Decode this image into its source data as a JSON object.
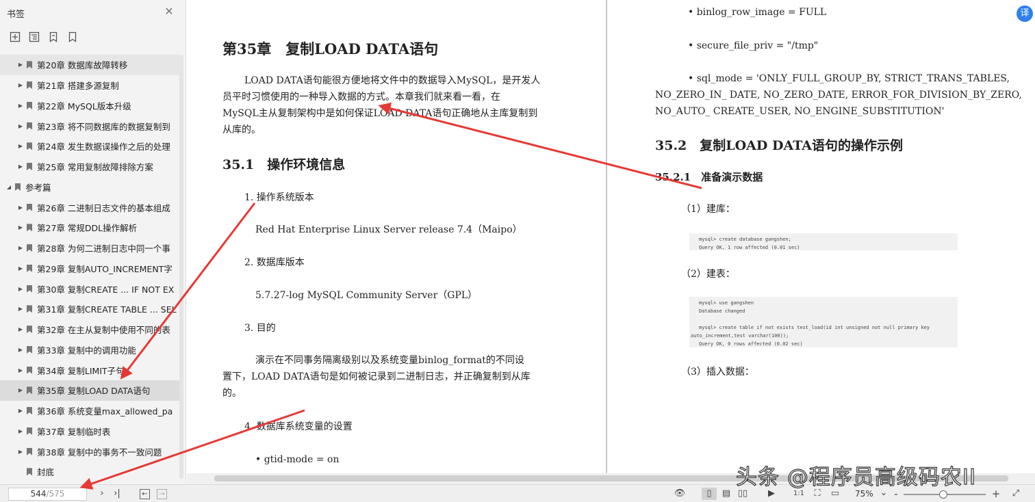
{
  "sidebar": {
    "title": "书签",
    "items": [
      {
        "label": "第20章 数据库故障转移",
        "expanded": false
      },
      {
        "label": "第21章 搭建多源复制",
        "expanded": false
      },
      {
        "label": "第22章 MySQL版本升级",
        "expanded": false
      },
      {
        "label": "第23章 将不同数据库的数据复制到",
        "expanded": false
      },
      {
        "label": "第24章 发生数据误操作之后的处理",
        "expanded": false
      },
      {
        "label": "第25章 常用复制故障排除方案",
        "expanded": false
      },
      {
        "label": "参考篇",
        "expanded": true
      },
      {
        "label": "第26章 二进制日志文件的基本组成",
        "expanded": false
      },
      {
        "label": "第27章 常规DDL操作解析",
        "expanded": false
      },
      {
        "label": "第28章 为何二进制日志中同一个事",
        "expanded": false
      },
      {
        "label": "第29章 复制AUTO_INCREMENT字",
        "expanded": false
      },
      {
        "label": "第30章 复制CREATE ... IF NOT EX",
        "expanded": false
      },
      {
        "label": "第31章 复制CREATE TABLE ... SEL",
        "expanded": false
      },
      {
        "label": "第32章 在主从复制中使用不同的表",
        "expanded": false
      },
      {
        "label": "第33章 复制中的调用功能",
        "expanded": false
      },
      {
        "label": "第34章 复制LIMIT子句",
        "expanded": false
      },
      {
        "label": "第35章 复制LOAD DATA语句",
        "expanded": false
      },
      {
        "label": "第36章 系统变量max_allowed_pa",
        "expanded": false
      },
      {
        "label": "第37章 复制临时表",
        "expanded": false
      },
      {
        "label": "第38章 复制中的事务不一致问题",
        "expanded": false
      },
      {
        "label": "封底",
        "expanded": null
      }
    ]
  },
  "left_page": {
    "chapter_title": "第35章　复制LOAD DATA语句",
    "intro": [
      "LOAD DATA语句能很方便地将文件中的数据导入MySQL，是开发人",
      "员平时习惯使用的一种导入数据的方式。本章我们就来看一看，在",
      "MySQL主从复制架构中是如何保证LOAD DATA语句正确地从主库复制到",
      "从库的。"
    ],
    "section1_title": "35.1　操作环境信息",
    "item1": "1. 操作系统版本",
    "item1_value": "Red Hat Enterprise Linux Server release 7.4（Maipo）",
    "item2": "2. 数据库版本",
    "item2_value": "5.7.27-log MySQL Community Server（GPL）",
    "item3": "3. 目的",
    "item3_text": [
      "演示在不同事务隔离级别以及系统变量binlog_format的不同设",
      "置下，LOAD DATA语句是如何被记录到二进制日志，并正确复制到从库",
      "的。"
    ],
    "item4": "4. 数据库系统变量的设置",
    "bullet_gtid": "• gtid-mode = on"
  },
  "right_page": {
    "bullet_binlog": "• binlog_row_image = FULL",
    "bullet_secure": "• secure_file_priv = \"/tmp\"",
    "sql_mode": [
      "• sql_mode = 'ONLY_FULL_GROUP_BY, STRICT_TRANS_TABLES,",
      "NO_ZERO_IN_ DATE, NO_ZERO_DATE, ERROR_FOR_DIVISION_BY_ZERO,",
      "NO_AUTO_ CREATE_USER, NO_ENGINE_SUBSTITUTION'"
    ],
    "section2_title": "35.2　复制LOAD DATA语句的操作示例",
    "subsection_title": "35.2.1　准备演示数据",
    "step1": "（1）建库：",
    "code1": [
      "mysql> create database gangshen;",
      "Query OK, 1 row affected (0.01 sec)"
    ],
    "step2": "（2）建表：",
    "code2": [
      "mysql> use gangshen",
      "Database changed",
      "",
      "mysql> create table if not exists test_load(id int unsigned not null primary key",
      "auto_increment,test varchar(100));",
      "Query OK, 0 rows affected (0.02 sec)"
    ],
    "step3": "（3）插入数据："
  },
  "statusbar": {
    "current_page": "544",
    "total_pages": "/575",
    "zoom": "75%",
    "zoom_minus": "-",
    "zoom_plus": "+"
  },
  "watermark": "头条 @程序员高级码农II",
  "colors": {
    "arrow": "#e53935",
    "selected_bookmark": "#dcdcdc"
  },
  "icons": [
    "add-bookmark-icon",
    "add-child-bookmark-icon",
    "bookmark-icon",
    "bookmark-outline-icon",
    "close-icon",
    "next-page-icon",
    "last-page-icon",
    "back-icon",
    "forward-icon",
    "eye-icon",
    "single-page-icon",
    "continuous-page-icon",
    "two-page-icon",
    "play-icon",
    "actual-size-icon",
    "fit-page-icon",
    "fit-width-icon",
    "rotate-icon"
  ]
}
